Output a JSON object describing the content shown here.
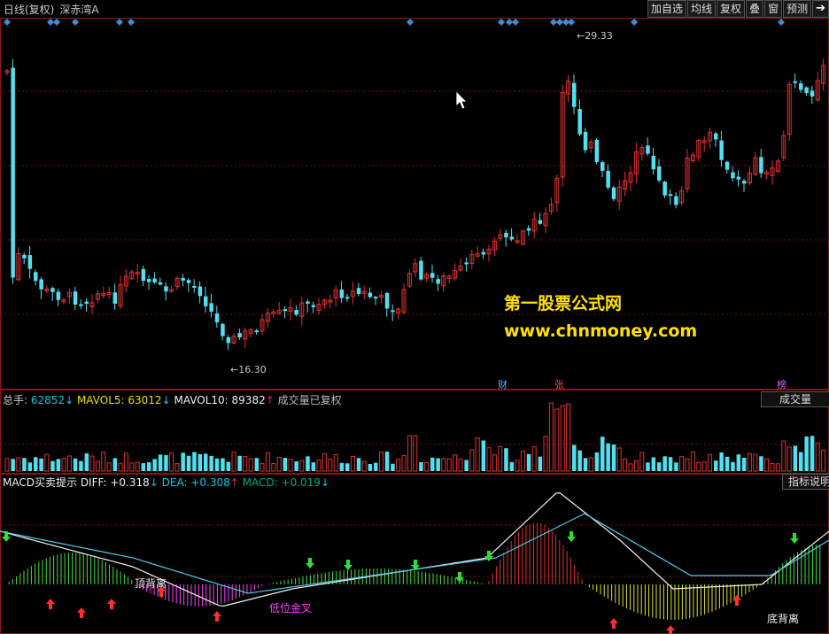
{
  "window": {
    "period": "日线(复权)",
    "stock_name": "深赤湾A"
  },
  "toolbar": {
    "buttons": [
      "加自选",
      "均线",
      "复权",
      "叠",
      "窗",
      "预测"
    ],
    "exit_icon": "exit-arrow-icon"
  },
  "price_panel": {
    "high_label": "29.33",
    "low_label": "16.30",
    "watermark_line1": "第一股票公式网",
    "watermark_line2": "www.chnmoney.com",
    "markers": [
      "财",
      "张",
      "榜"
    ]
  },
  "volume_panel": {
    "total_label": "总手:",
    "total_value": "62852",
    "total_arrow": "↓",
    "mavol5_label": "MAVOL5:",
    "mavol5_value": "63012",
    "mavol5_arrow": "↓",
    "mavol10_label": "MAVOL10:",
    "mavol10_value": "89382",
    "mavol10_arrow": "↑",
    "note": "成交量已复权",
    "button": "成交量"
  },
  "macd_panel": {
    "name": "MACD买卖提示",
    "diff_label": "DIFF:",
    "diff_value": "+0.318",
    "diff_arrow": "↓",
    "dea_label": "DEA:",
    "dea_value": "+0.308",
    "dea_arrow": "↑",
    "macd_label": "MACD:",
    "macd_value": "+0.019",
    "macd_arrow": "↓",
    "button": "指标说明",
    "annotations": [
      "顶背离",
      "低位金叉",
      "底背离"
    ]
  },
  "colors": {
    "up": "#e03030",
    "down": "#50e0f0",
    "diamond": "#3a8fd8",
    "grid": "#7a1010",
    "watermark": "#ffe000"
  }
}
